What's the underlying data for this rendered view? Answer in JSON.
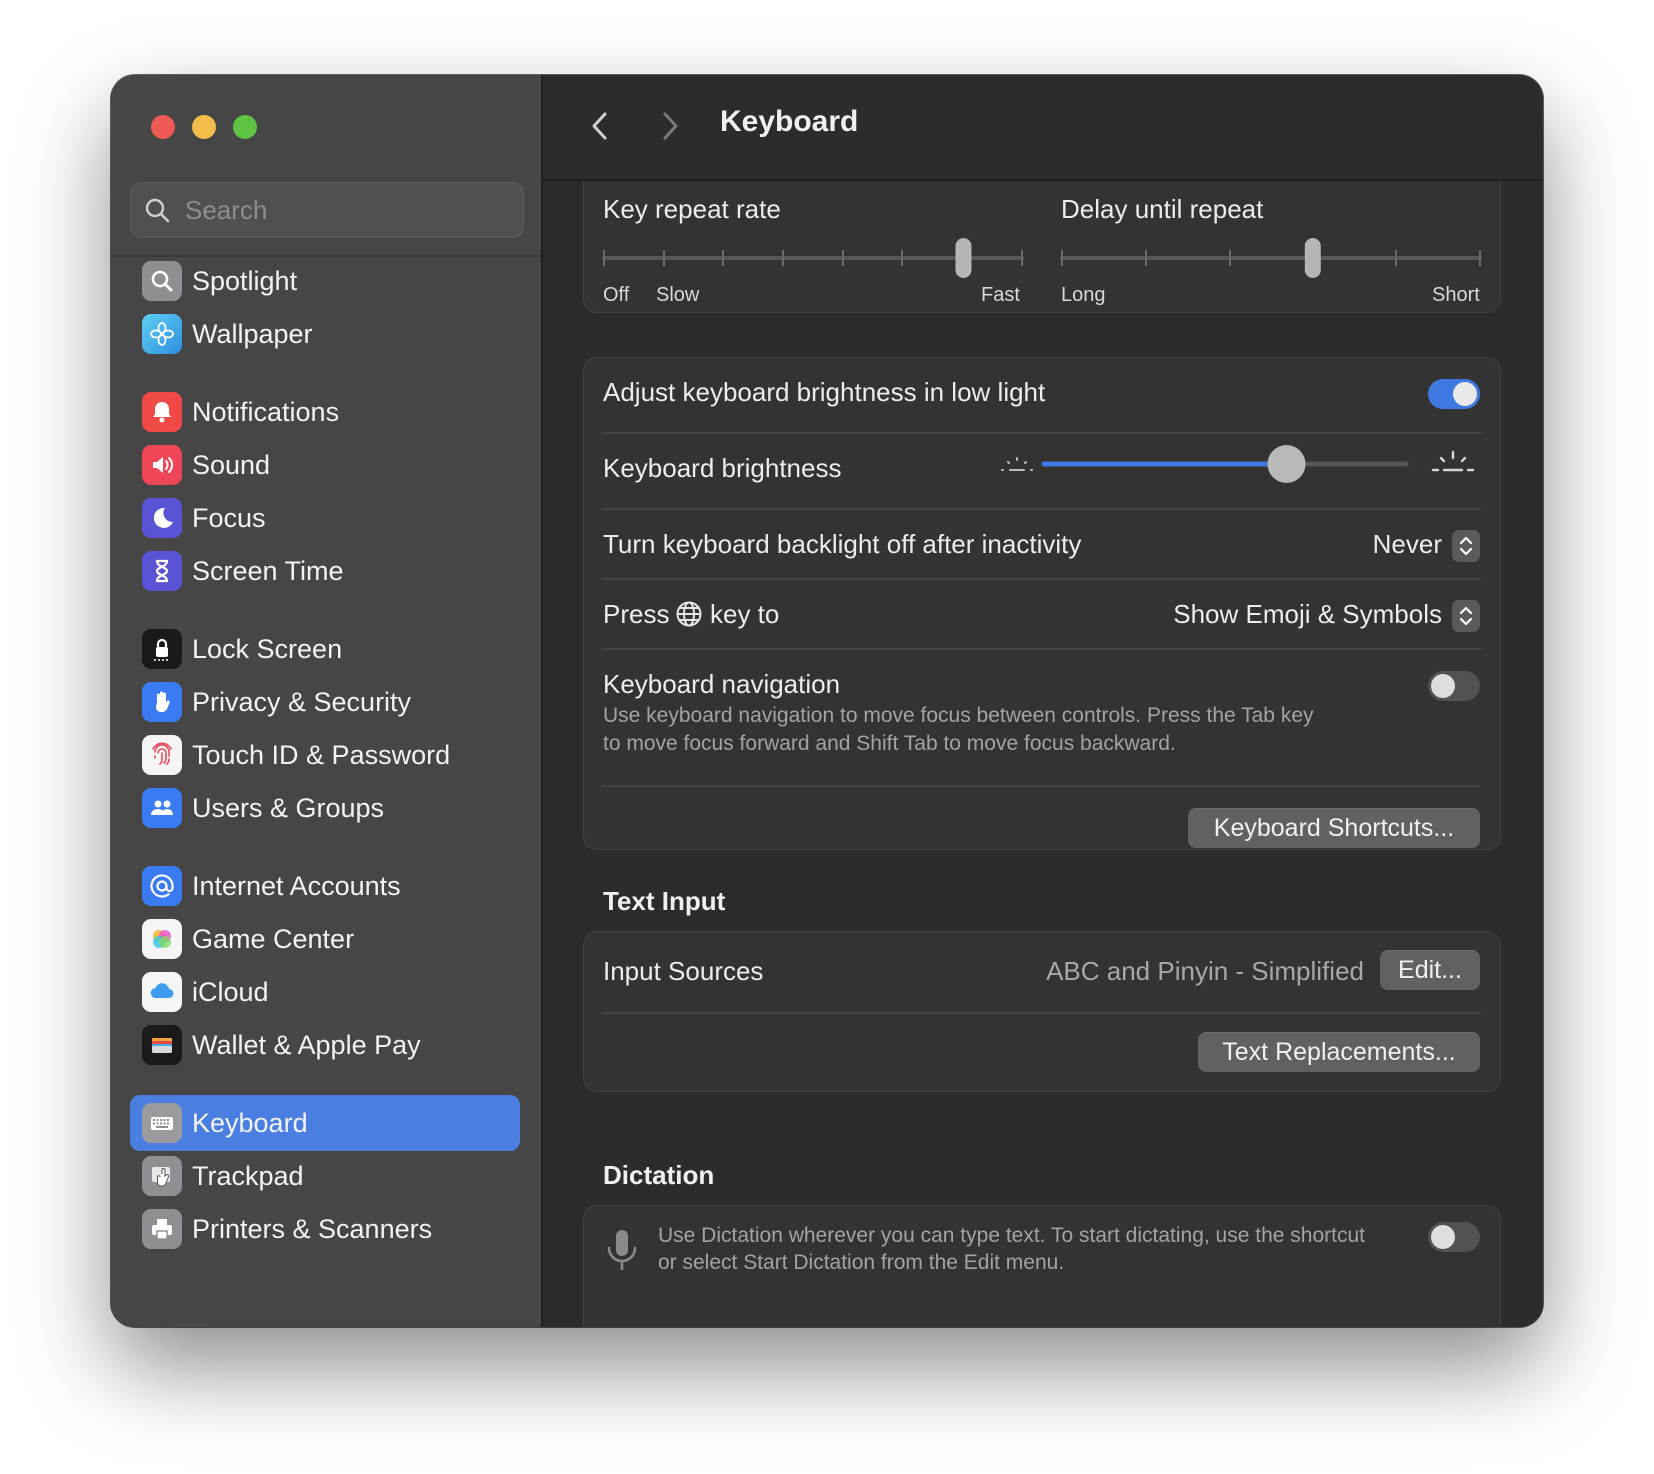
{
  "window": {
    "title": "Keyboard"
  },
  "search": {
    "placeholder": "Search"
  },
  "sidebar": {
    "items": [
      {
        "label": "Spotlight",
        "icon": "spotlight-icon",
        "color": "#8e8e93"
      },
      {
        "label": "Wallpaper",
        "icon": "wallpaper-icon",
        "color": "#37b6e9"
      },
      {
        "label": "Notifications",
        "icon": "notifications-icon",
        "color": "#ef4a46"
      },
      {
        "label": "Sound",
        "icon": "sound-icon",
        "color": "#ee4657"
      },
      {
        "label": "Focus",
        "icon": "focus-icon",
        "color": "#5b53d6"
      },
      {
        "label": "Screen Time",
        "icon": "screen-time-icon",
        "color": "#5b53d6"
      },
      {
        "label": "Lock Screen",
        "icon": "lock-screen-icon",
        "color": "#1a1a1a"
      },
      {
        "label": "Privacy & Security",
        "icon": "privacy-hand-icon",
        "color": "#3a7af2"
      },
      {
        "label": "Touch ID & Password",
        "icon": "fingerprint-icon",
        "color": "#f5f5f5"
      },
      {
        "label": "Users & Groups",
        "icon": "users-icon",
        "color": "#3a7af2"
      },
      {
        "label": "Internet Accounts",
        "icon": "at-sign-icon",
        "color": "#3a7af2"
      },
      {
        "label": "Game Center",
        "icon": "game-center-icon",
        "color": "#f5f5f5"
      },
      {
        "label": "iCloud",
        "icon": "icloud-icon",
        "color": "#f5f5f5"
      },
      {
        "label": "Wallet & Apple Pay",
        "icon": "wallet-icon",
        "color": "#1a1a1a"
      },
      {
        "label": "Keyboard",
        "icon": "keyboard-icon",
        "color": "#8e8e93",
        "active": true
      },
      {
        "label": "Trackpad",
        "icon": "trackpad-icon",
        "color": "#8e8e93"
      },
      {
        "label": "Printers & Scanners",
        "icon": "printer-icon",
        "color": "#8e8e93"
      }
    ]
  },
  "key_repeat": {
    "label": "Key repeat rate",
    "off_label": "Off",
    "slow_label": "Slow",
    "fast_label": "Fast",
    "value_fraction": 0.86
  },
  "delay_repeat": {
    "label": "Delay until repeat",
    "long_label": "Long",
    "short_label": "Short",
    "value_fraction": 0.6
  },
  "brightness_card": {
    "adjust_label": "Adjust keyboard brightness in low light",
    "adjust_on": true,
    "brightness_label": "Keyboard brightness",
    "brightness_fraction": 0.67,
    "backlight_label": "Turn keyboard backlight off after inactivity",
    "backlight_value": "Never",
    "press_label_pre": "Press",
    "press_label_post": "key to",
    "press_value": "Show Emoji & Symbols",
    "nav_label": "Keyboard navigation",
    "nav_desc_1": "Use keyboard navigation to move focus between controls. Press the Tab key",
    "nav_desc_2": "to move focus forward and Shift Tab to move focus backward.",
    "nav_on": false,
    "shortcuts_button": "Keyboard Shortcuts..."
  },
  "text_input": {
    "heading": "Text Input",
    "sources_label": "Input Sources",
    "sources_value": "ABC and Pinyin - Simplified",
    "edit_button": "Edit...",
    "replacements_button": "Text Replacements..."
  },
  "dictation": {
    "heading": "Dictation",
    "desc_1": "Use Dictation wherever you can type text. To start dictating, use the shortcut",
    "desc_2": "or select Start Dictation from the Edit menu.",
    "on": false
  },
  "colors": {
    "accent": "#4a7ee0",
    "toggle_on": "#3f78e0"
  }
}
